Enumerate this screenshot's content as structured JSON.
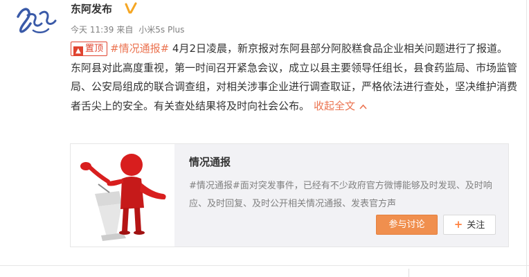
{
  "post": {
    "author": "东阿发布",
    "time": "今天 11:39",
    "from_label": "来自",
    "device": "小米5s Plus",
    "pin_label": "置顶",
    "hashtag": "#情况通报#",
    "body": " 4月2日凌晨，新京报对东阿县部分阿胶糕食品企业相关问题进行了报道。东阿县对此高度重视，第一时间召开紧急会议，成立以县主要领导任组长，县食药监局、市场监管局、公安局组成的联合调查组，对相关涉事企业进行调查取证，严格依法进行查处，坚决维护消费者舌尖上的安全。有关查处结果将及时向社会公布。",
    "collapse_label": "收起全文"
  },
  "card": {
    "title": "情况通报",
    "description": "#情况通报#面对突发事件，已经有不少政府官方微博能够及时发现、及时响应、及时回复、及时公开相关情况通报、发表官方声",
    "join_label": "参与讨论",
    "follow_label": "关注"
  },
  "colors": {
    "accent": "#eb7350",
    "pin_red": "#e0432f",
    "join_button": "#f08f4e"
  },
  "icons": {
    "avatar": "calligraphy-avatar",
    "verified": "verified-v-icon",
    "pin": "pin-top-icon",
    "collapse": "chevron-up-icon",
    "card_image": "red-figure-podium-illustration",
    "plus": "plus-icon"
  }
}
